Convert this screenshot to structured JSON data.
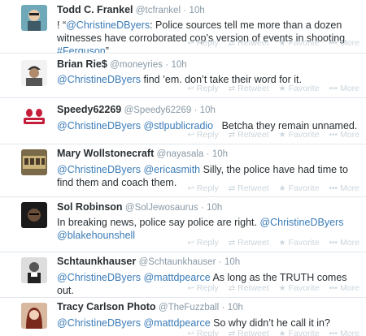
{
  "tweets": [
    {
      "name": "Todd C. Frankel",
      "handle": "@tcfrankel",
      "time": "10h",
      "text_prefix": "! “",
      "mention1": "@ChristineDByers",
      "text_middle": ": Police sources tell me more than a dozen witnesses have corroborated cop’s version of events in shooting ",
      "hashtag": "#Ferguson",
      "text_suffix": "”"
    },
    {
      "name": "Brian Rie$",
      "handle": "@moneyries",
      "time": "10h",
      "mention1": "@ChristineDByers",
      "text": " find ’em. don’t take their word for it."
    },
    {
      "name": "Speedy62269",
      "handle": "@Speedy62269",
      "time": "10h",
      "mention1": "@ChristineDByers",
      "mention2": "@stlpublicradio",
      "text": "Betcha they remain unnamed."
    },
    {
      "name": "Mary Wollstonecraft",
      "handle": "@nayasala",
      "time": "10h",
      "mention1": "@ChristineDByers",
      "mention2": "@ericasmith",
      "text": " Silly, the police have had time to find them and coach them."
    },
    {
      "name": "Sol Robinson",
      "handle": "@SolJewosaurus",
      "time": "10h",
      "text": "In breaking news, police say police are right. ",
      "mention1": "@ChristineDByers",
      "mention2": "@blakehounshell"
    },
    {
      "name": "Schtaunkhauser",
      "handle": "@Schtaunkhauser",
      "time": "10h",
      "mention1": "@ChristineDByers",
      "mention2": "@mattdpearce",
      "text": " As long as the TRUTH comes out."
    },
    {
      "name": "Tracy Carlson Photo",
      "handle": "@TheFuzzball",
      "time": "10h",
      "mention1": "@ChristineDByers",
      "mention2": "@mattdpearce",
      "text": " So why didn’t he call it in?"
    }
  ],
  "actions": {
    "reply": "Reply",
    "retweet": "Retweet",
    "favorite": "Favorite",
    "more": "More"
  },
  "separator": "·",
  "icons": {
    "reply": "reply-icon",
    "retweet": "retweet-icon",
    "favorite": "star-icon",
    "more": "more-icon"
  },
  "colors": {
    "link": "#3a7bb7",
    "muted": "#8899a6",
    "action": "#ccd6dd",
    "divider": "#e1e8ed"
  }
}
